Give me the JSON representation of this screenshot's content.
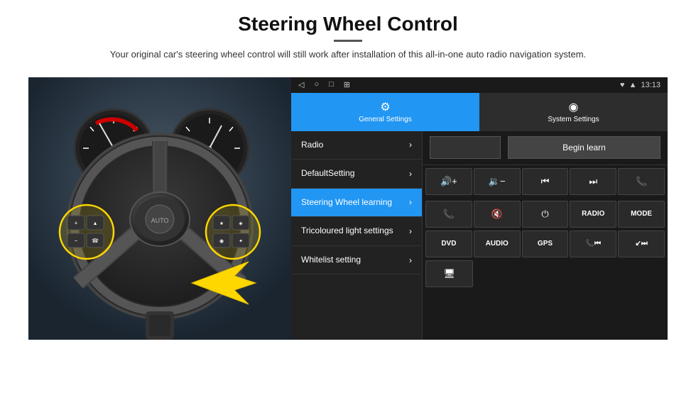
{
  "header": {
    "title": "Steering Wheel Control",
    "divider": true,
    "subtitle": "Your original car's steering wheel control will still work after installation of this all-in-one auto radio navigation system."
  },
  "device": {
    "status_bar": {
      "nav_icons": [
        "◁",
        "○",
        "□",
        "⊞"
      ],
      "status_icons": [
        "♥",
        "▲",
        "13:13"
      ]
    },
    "tabs": [
      {
        "id": "general",
        "icon": "⚙",
        "label": "General Settings",
        "active": true
      },
      {
        "id": "system",
        "icon": "◉",
        "label": "System Settings",
        "active": false
      }
    ],
    "menu_items": [
      {
        "id": "radio",
        "label": "Radio",
        "active": false
      },
      {
        "id": "default-setting",
        "label": "DefaultSetting",
        "active": false
      },
      {
        "id": "steering-wheel",
        "label": "Steering Wheel learning",
        "active": true
      },
      {
        "id": "tricoloured",
        "label": "Tricoloured light settings",
        "active": false
      },
      {
        "id": "whitelist",
        "label": "Whitelist setting",
        "active": false
      }
    ],
    "begin_learn_label": "Begin learn",
    "control_buttons_row1": [
      {
        "id": "vol-up",
        "icon": "🔊+",
        "type": "icon"
      },
      {
        "id": "vol-down",
        "icon": "🔉−",
        "type": "icon"
      },
      {
        "id": "prev-track",
        "icon": "⏮",
        "type": "icon"
      },
      {
        "id": "next-track",
        "icon": "⏭",
        "type": "icon"
      },
      {
        "id": "phone",
        "icon": "📞",
        "type": "icon"
      }
    ],
    "control_buttons_row2": [
      {
        "id": "call-answer",
        "icon": "📞",
        "type": "icon"
      },
      {
        "id": "mute",
        "icon": "🔇",
        "type": "icon"
      },
      {
        "id": "power",
        "icon": "⏻",
        "type": "icon"
      },
      {
        "id": "radio-btn",
        "label": "RADIO",
        "type": "text"
      },
      {
        "id": "mode-btn",
        "label": "MODE",
        "type": "text"
      }
    ],
    "control_buttons_row3": [
      {
        "id": "dvd-btn",
        "label": "DVD",
        "type": "text"
      },
      {
        "id": "audio-btn",
        "label": "AUDIO",
        "type": "text"
      },
      {
        "id": "gps-btn",
        "label": "GPS",
        "type": "text"
      },
      {
        "id": "phone2",
        "icon": "📞⏮",
        "type": "icon"
      },
      {
        "id": "next2",
        "icon": "↙⏭",
        "type": "icon"
      }
    ],
    "control_buttons_row4": [
      {
        "id": "screen-btn",
        "icon": "🖥",
        "type": "icon"
      }
    ]
  }
}
